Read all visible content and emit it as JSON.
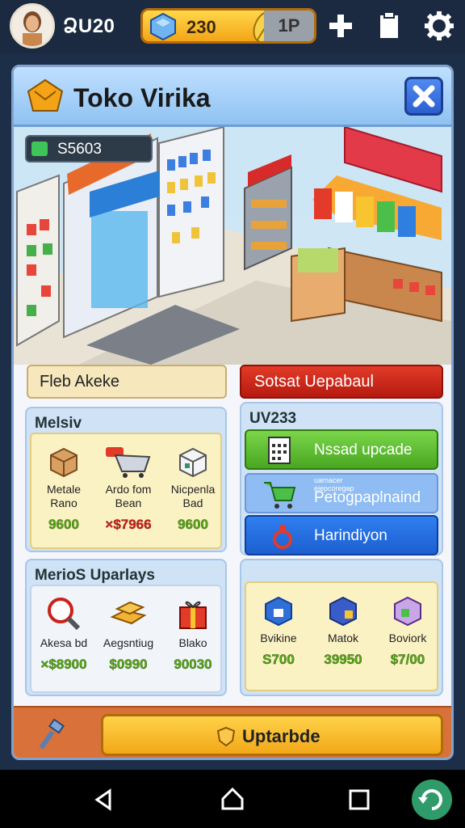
{
  "top_bar": {
    "player_name": "ՁU20",
    "currency_amount": "230",
    "level_value": "1P",
    "icons": [
      "avatar",
      "gem-icon",
      "leaf-icon",
      "plus-icon",
      "clipboard-icon",
      "gear-icon"
    ]
  },
  "panel": {
    "title": "Toko Virika",
    "title_icon": "shop-icon",
    "close_icon": "close-icon",
    "scene_money": "S5603",
    "tabs": {
      "left": "Fleb Akeke",
      "right": "Sotsat Uepabaul"
    },
    "section_a": {
      "title": "Melsiv",
      "items": [
        {
          "name": "Metale\nRano",
          "price": "9600",
          "icon": "box-icon"
        },
        {
          "name": "Ardo fom\nBean",
          "price": "×$7966",
          "icon": "cart-icon"
        },
        {
          "name": "Nicpenla\nBad",
          "price": "9600",
          "icon": "cube-icon"
        }
      ]
    },
    "section_b": {
      "title": "UV233",
      "buttons": [
        {
          "label": "Nssad upcade",
          "icon": "calculator-icon"
        },
        {
          "label": "Petogpaplnaind",
          "icon": "cart-icon",
          "caption": "uarnacer\neiepcoregap"
        },
        {
          "label": "Harindiyon",
          "icon": "hanger-icon"
        }
      ]
    },
    "section_c": {
      "title": "MerioS Uparlays",
      "items": [
        {
          "name": "Akesa bd",
          "price": "×$8900",
          "icon": "magnifier-icon"
        },
        {
          "name": "Aegsntiug",
          "price": "$0990",
          "icon": "gold-bars-icon"
        },
        {
          "name": "Blako",
          "price": "90030",
          "icon": "gift-icon"
        }
      ]
    },
    "section_d": {
      "items": [
        {
          "name": "Bvikine",
          "price": "S700",
          "icon": "blue-box-icon"
        },
        {
          "name": "Matok",
          "price": "39950",
          "icon": "crate-icon"
        },
        {
          "name": "Boviork",
          "price": "$7/00",
          "icon": "purple-box-icon"
        }
      ]
    },
    "footer": {
      "upgrade_label": "Uptarbde",
      "hammer_icon": "hammer-icon",
      "shield_icon": "shield-icon"
    }
  },
  "navbar": {
    "icons": [
      "back-icon",
      "home-icon",
      "recents-icon",
      "refresh-icon"
    ]
  },
  "colors": {
    "accent": "#f4a417",
    "panel_border": "#7fa2cf",
    "sale_red": "#c9221a",
    "price_green": "#5aa81a"
  }
}
